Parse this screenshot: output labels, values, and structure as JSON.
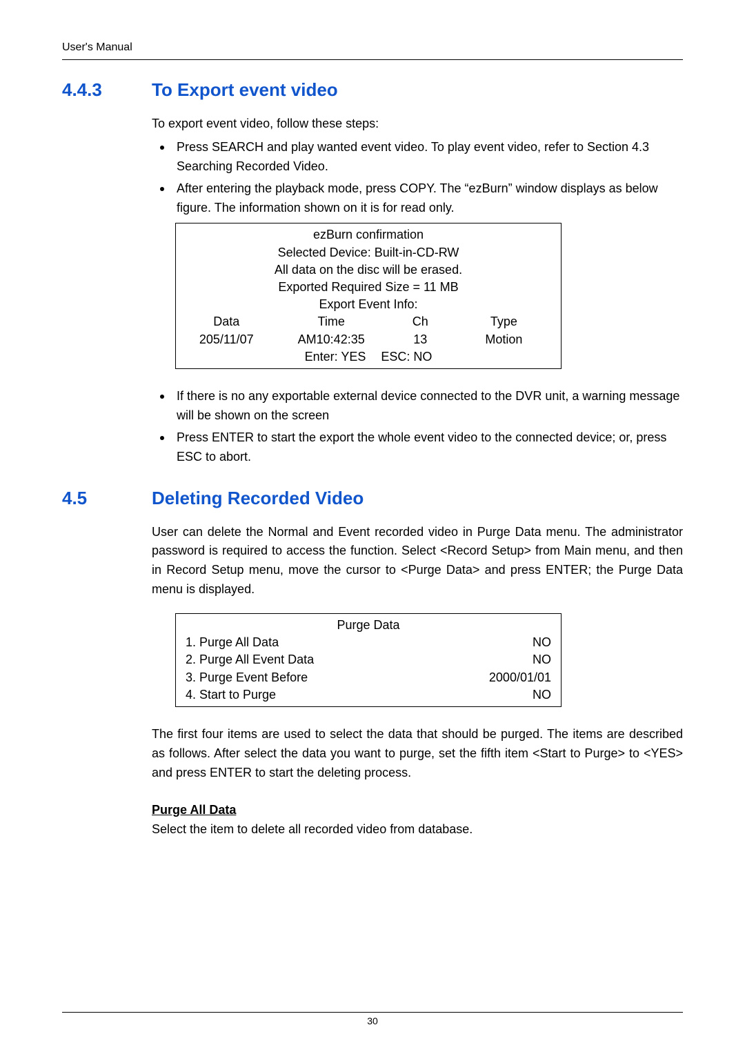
{
  "header": "User's Manual",
  "s1": {
    "num": "4.4.3",
    "title": "To Export event video",
    "intro": "To export event video, follow these steps:",
    "b1": "Press SEARCH and play wanted event video. To play event video, refer to Section 4.3 Searching Recorded Video.",
    "b2": "After entering the playback mode, press COPY. The “ezBurn” window displays as below figure. The information shown on it is for read only."
  },
  "ezburn": {
    "title": "ezBurn confirmation",
    "l1": "Selected Device: Built-in-CD-RW",
    "l2": "All data on the disc will be erased.",
    "l3": "Exported Required Size = 11 MB",
    "l4": "Export Event Info:",
    "h1": "Data",
    "h2": "Time",
    "h3": "Ch",
    "h4": "Type",
    "d1": "205/11/07",
    "d2": "AM10:42:35",
    "d3": "13",
    "d4": "Motion",
    "enter": "Enter: YES",
    "esc": "ESC: NO"
  },
  "s1b3": "If there is no any exportable external device connected to the DVR unit, a warning message will be shown on the screen",
  "s1b4": "Press ENTER to start the export the whole event video to the connected device; or, press ESC to abort.",
  "s2": {
    "num": "4.5",
    "title": "Deleting Recorded Video",
    "p1": "User can delete the Normal and Event recorded video in Purge Data menu. The administrator password is required to access the function. Select <Record Setup> from Main menu, and then in Record Setup menu, move the cursor to <Purge Data> and press ENTER; the Purge Data menu is displayed."
  },
  "purge": {
    "title": "Purge Data",
    "r1k": "1. Purge All Data",
    "r1v": "NO",
    "r2k": "2. Purge All Event Data",
    "r2v": "NO",
    "r3k": "3. Purge Event Before",
    "r3v": "2000/01/01",
    "r4k": "4. Start to Purge",
    "r4v": "NO"
  },
  "s2p2": "The first four items are used to select the data that should be purged. The items are described as follows. After select the data you want to purge, set the fifth item <Start to Purge> to <YES> and press ENTER to start the deleting process.",
  "sub": {
    "h": "Purge All Data",
    "p": "Select the item to delete all recorded video from database."
  },
  "pageno": "30"
}
